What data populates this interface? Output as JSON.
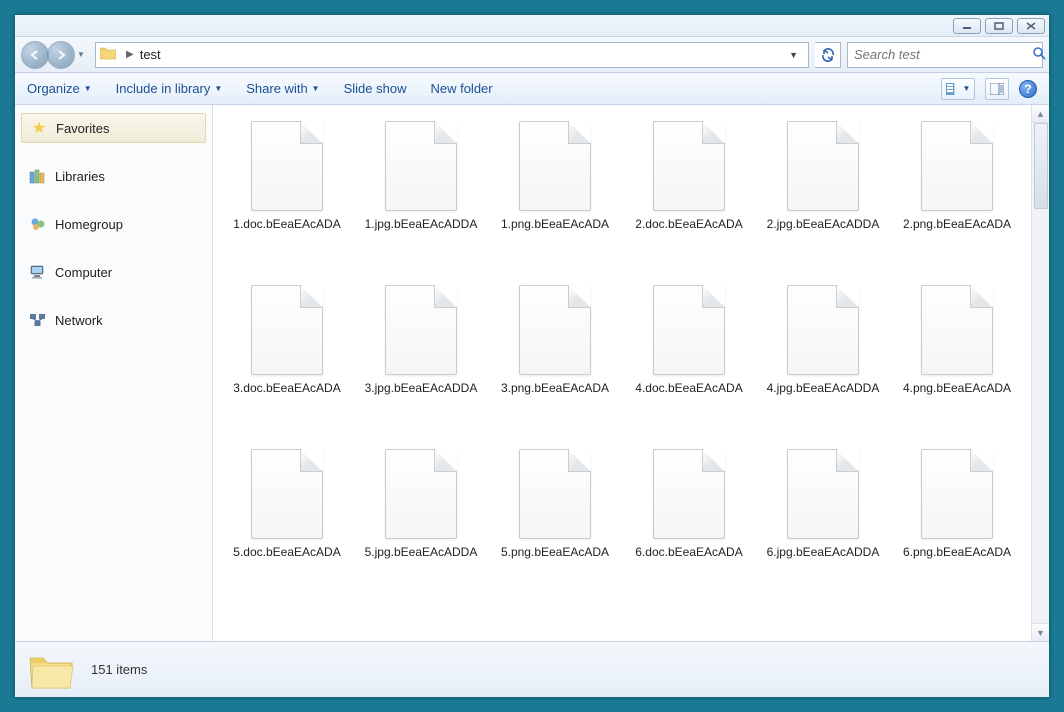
{
  "breadcrumb": {
    "location": "test"
  },
  "search": {
    "placeholder": "Search test"
  },
  "toolbar": {
    "organize": "Organize",
    "include": "Include in library",
    "share": "Share with",
    "slideshow": "Slide show",
    "newfolder": "New folder"
  },
  "sidebar": {
    "favorites": "Favorites",
    "libraries": "Libraries",
    "homegroup": "Homegroup",
    "computer": "Computer",
    "network": "Network"
  },
  "files": [
    "1.doc.bEeaEAcADA",
    "1.jpg.bEeaEAcADDA",
    "1.png.bEeaEAcADA",
    "2.doc.bEeaEAcADA",
    "2.jpg.bEeaEAcADDA",
    "2.png.bEeaEAcADA",
    "3.doc.bEeaEAcADA",
    "3.jpg.bEeaEAcADDA",
    "3.png.bEeaEAcADA",
    "4.doc.bEeaEAcADA",
    "4.jpg.bEeaEAcADDA",
    "4.png.bEeaEAcADA",
    "5.doc.bEeaEAcADA",
    "5.jpg.bEeaEAcADDA",
    "5.png.bEeaEAcADA",
    "6.doc.bEeaEAcADA",
    "6.jpg.bEeaEAcADDA",
    "6.png.bEeaEAcADA"
  ],
  "status": {
    "count": "151 items"
  }
}
